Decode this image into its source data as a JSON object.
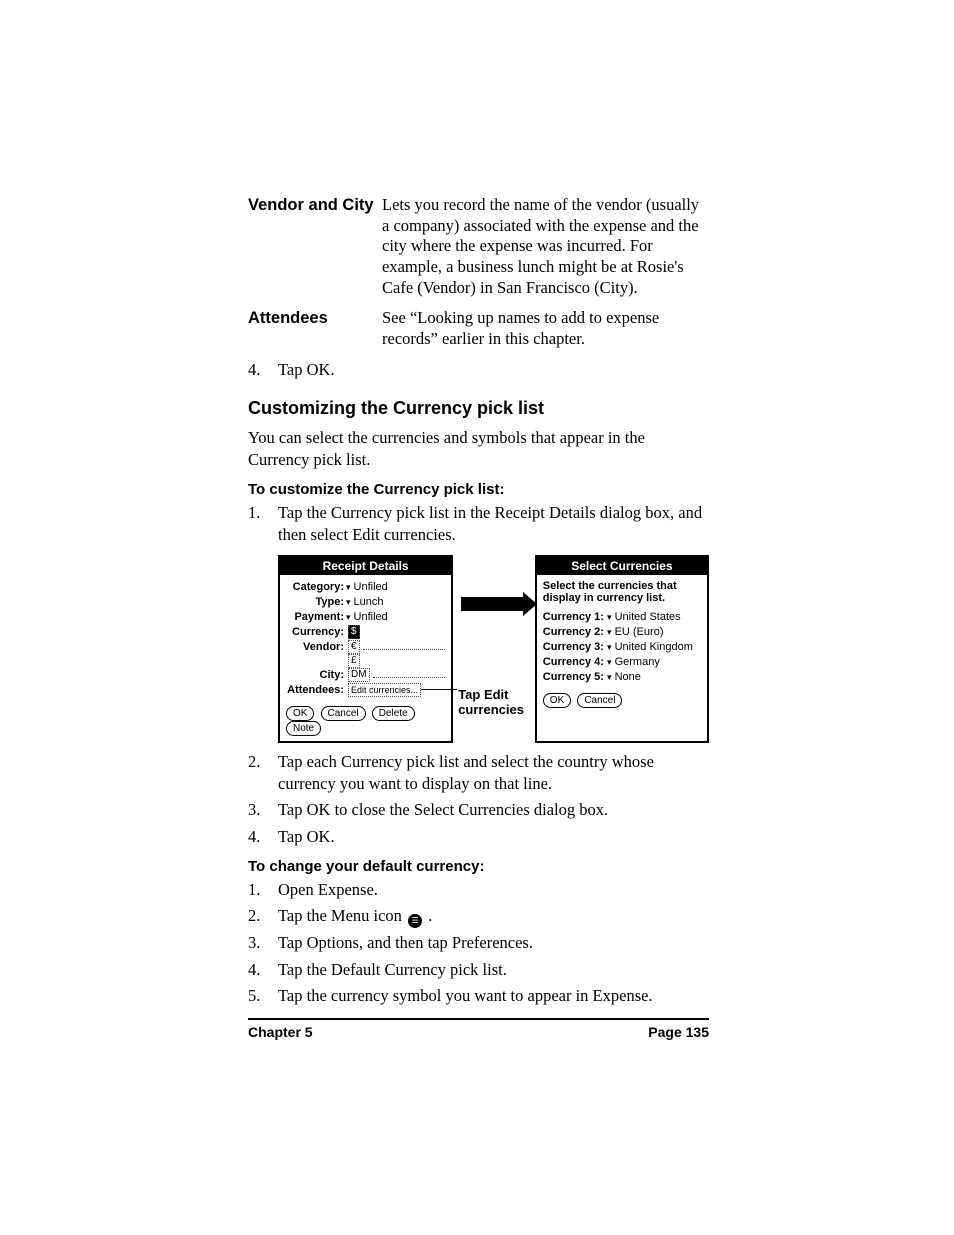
{
  "defs": {
    "vendorCity": {
      "term": "Vendor and City",
      "body": "Lets you record the name of the vendor (usually a company) associated with the expense and the city where the expense was incurred. For example, a business lunch might be at Rosie's Cafe (Vendor) in San Francisco (City)."
    },
    "attendees": {
      "term": "Attendees",
      "body": "See “Looking up names to add to expense records” earlier in this chapter."
    }
  },
  "stepTapOk": {
    "num": "4.",
    "text": "Tap OK."
  },
  "heading": "Customizing the Currency pick list",
  "intro": "You can select the currencies and symbols that appear in the Currency pick list.",
  "proc1Title": "To customize the Currency pick list:",
  "proc1": [
    {
      "num": "1.",
      "text": "Tap the Currency pick list in the Receipt Details dialog box, and then select Edit currencies."
    },
    {
      "num": "2.",
      "text": "Tap each Currency pick list and select the country whose currency you want to display on that line."
    },
    {
      "num": "3.",
      "text": "Tap OK to close the Select Currencies dialog box."
    },
    {
      "num": "4.",
      "text": "Tap OK."
    }
  ],
  "proc2Title": "To change your default currency:",
  "proc2": [
    {
      "num": "1.",
      "text": "Open Expense."
    },
    {
      "num": "2.",
      "pre": "Tap the Menu icon ",
      "post": " ."
    },
    {
      "num": "3.",
      "text": "Tap Options, and then tap Preferences."
    },
    {
      "num": "4.",
      "text": "Tap the Default Currency pick list."
    },
    {
      "num": "5.",
      "text": "Tap the currency symbol you want to appear in Expense."
    }
  ],
  "figure": {
    "receipt": {
      "title": "Receipt Details",
      "category": {
        "label": "Category:",
        "value": "Unfiled"
      },
      "type": {
        "label": "Type:",
        "value": "Lunch"
      },
      "payment": {
        "label": "Payment:",
        "value": "Unfiled"
      },
      "currency": {
        "label": "Currency:",
        "value": "$"
      },
      "vendor": {
        "label": "Vendor:"
      },
      "city": {
        "label": "City:"
      },
      "attendees": {
        "label": "Attendees:",
        "value": "Edit currencies..."
      },
      "options": [
        "€",
        "£",
        "DM"
      ],
      "buttons": {
        "ok": "OK",
        "cancel": "Cancel",
        "delete": "Delete",
        "note": "Note"
      }
    },
    "midCaption": "Tap Edit currencies",
    "select": {
      "title": "Select Currencies",
      "instr": "Select the currencies that display in currency list.",
      "rows": [
        {
          "label": "Currency 1:",
          "value": "United States"
        },
        {
          "label": "Currency 2:",
          "value": "EU (Euro)"
        },
        {
          "label": "Currency 3:",
          "value": "United Kingdom"
        },
        {
          "label": "Currency 4:",
          "value": "Germany"
        },
        {
          "label": "Currency 5:",
          "value": "None"
        }
      ],
      "buttons": {
        "ok": "OK",
        "cancel": "Cancel"
      }
    }
  },
  "footer": {
    "left": "Chapter 5",
    "right": "Page 135"
  }
}
